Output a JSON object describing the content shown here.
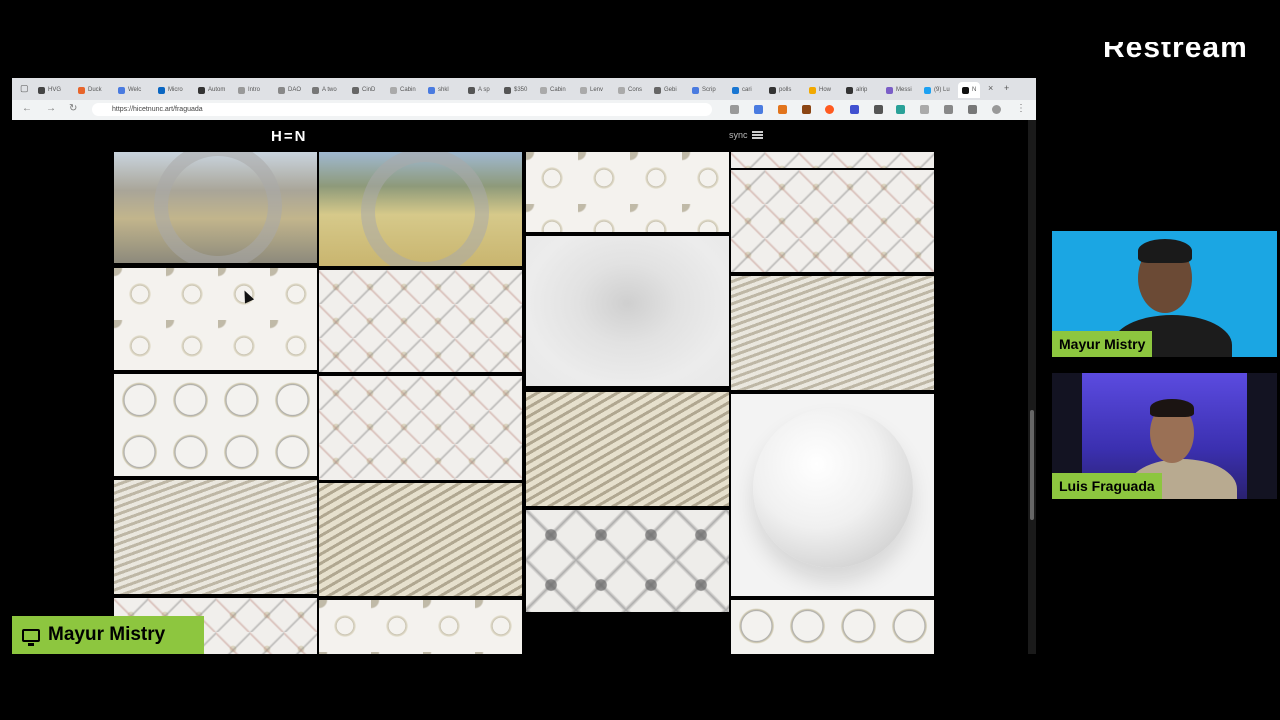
{
  "stream": {
    "brand": "Restream",
    "presenter_label": "Mayur Mistry"
  },
  "browser": {
    "tabs": [
      "HVG",
      "Duck",
      "Welc",
      "Micro",
      "Autom",
      "Intro",
      "DAO",
      "A two",
      "CinD",
      "Cabin",
      "shkl",
      "A sp",
      "$350",
      "Cabin",
      "Lenv",
      "Cons",
      "Gebi",
      "Scrip",
      "cari",
      "polls",
      "How",
      "alrip",
      "Messi",
      "(9) Lu",
      "N"
    ],
    "url": "https://hicetnunc.art/fraguada",
    "site_logo": "H=N",
    "menu_label": "sync"
  },
  "participants": [
    {
      "name": "Mayur Mistry"
    },
    {
      "name": "Luis Fraguada"
    }
  ],
  "colors": {
    "nametag": "#8dc63f",
    "cam1_bg": "#1ba6e3",
    "cam2_bg": "#3b30b0"
  }
}
